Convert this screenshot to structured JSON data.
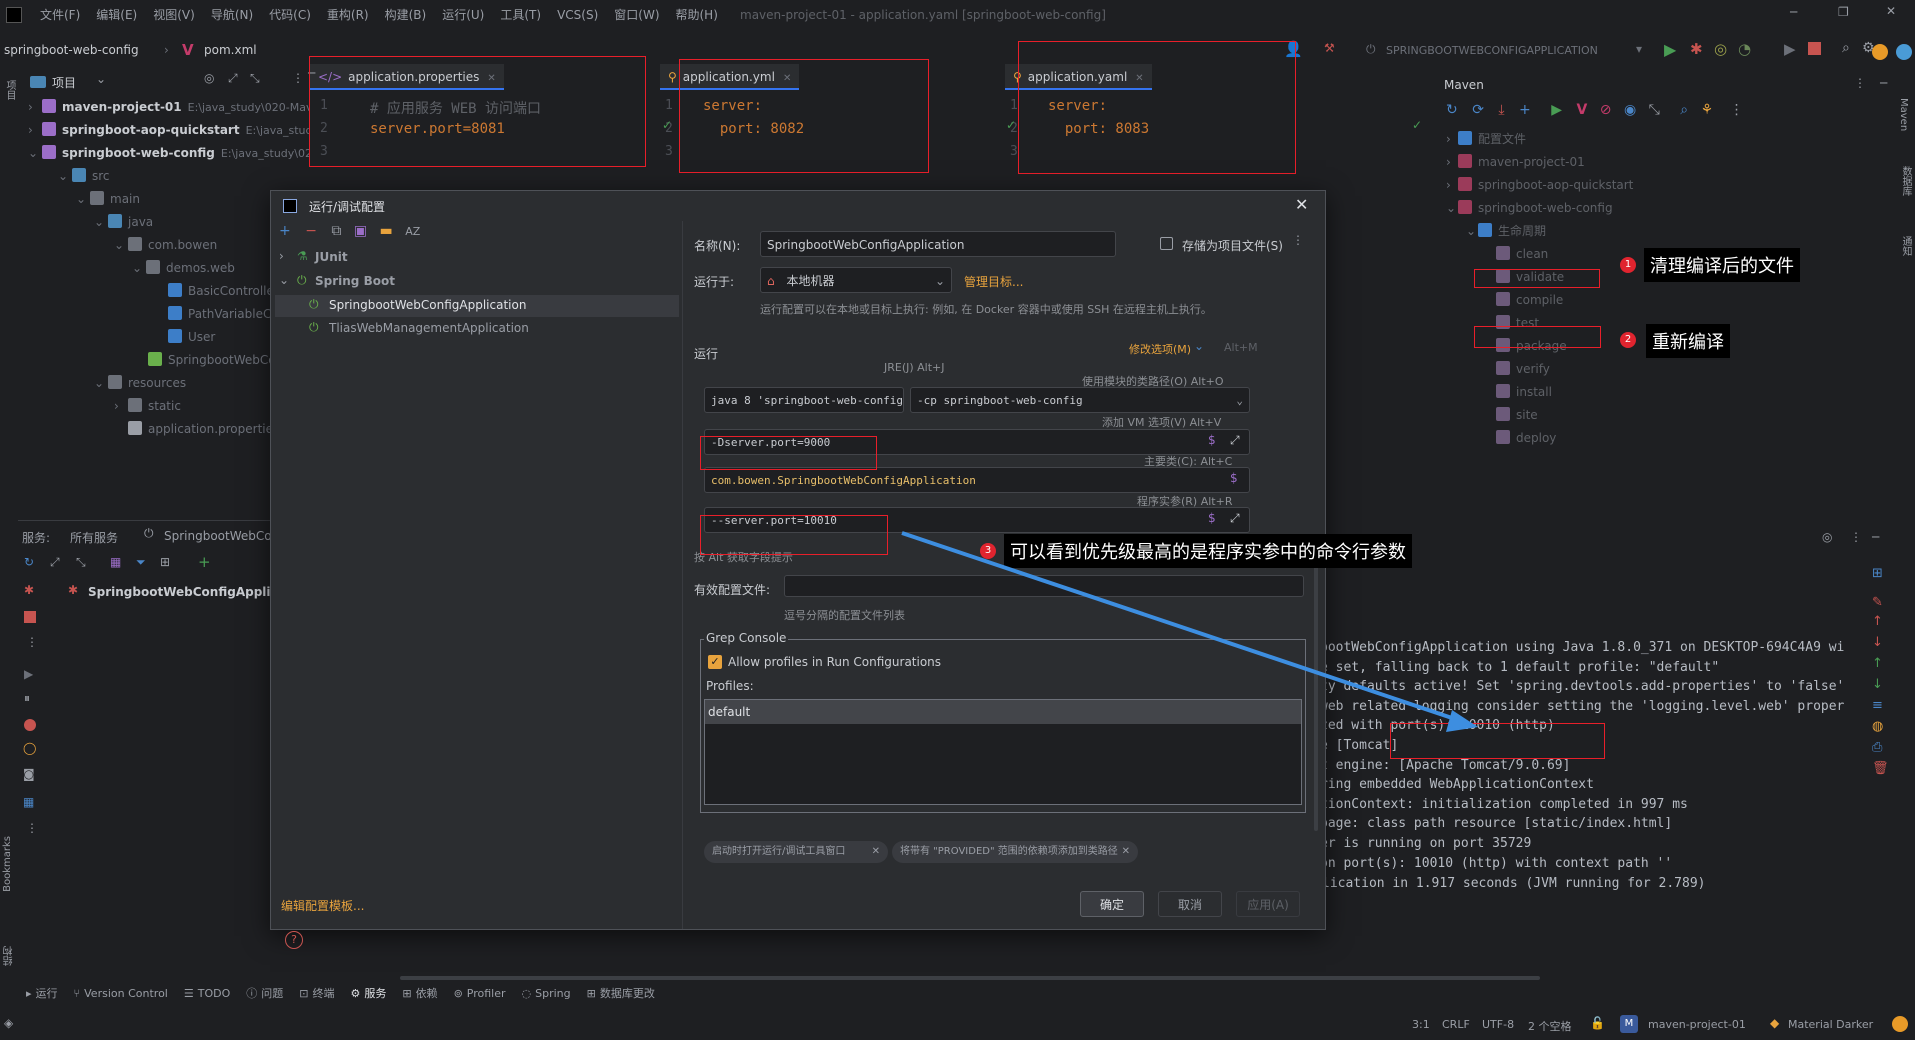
{
  "menubar": {
    "items": [
      "文件(F)",
      "编辑(E)",
      "视图(V)",
      "导航(N)",
      "代码(C)",
      "重构(R)",
      "构建(B)",
      "运行(U)",
      "工具(T)",
      "VCS(S)",
      "窗口(W)",
      "帮助(H)"
    ],
    "window_title": "maven-project-01 - application.yaml [springboot-web-config]"
  },
  "navbar": {
    "project": "springboot-web-config",
    "file": "pom.xml",
    "run_config": "SPRINGBOOTWEBCONFIGAPPLICATION"
  },
  "project_panel": {
    "title": "项目",
    "tree": [
      {
        "label": "maven-project-01",
        "path": "E:\\java_study\\020-Maven\\m"
      },
      {
        "label": "springboot-aop-quickstart",
        "path": "E:\\java_study\\022"
      },
      {
        "label": "springboot-web-config",
        "path": "E:\\java_study\\020-M"
      },
      {
        "label": "src"
      },
      {
        "label": "main"
      },
      {
        "label": "java"
      },
      {
        "label": "com.bowen"
      },
      {
        "label": "demos.web"
      },
      {
        "label": "BasicController"
      },
      {
        "label": "PathVariableContro"
      },
      {
        "label": "User"
      },
      {
        "label": "SpringbootWebConfi"
      },
      {
        "label": "resources"
      },
      {
        "label": "static"
      },
      {
        "label": "application.properties"
      }
    ]
  },
  "editors": [
    {
      "tab": "application.properties",
      "lines": [
        "# 应用服务 WEB 访问端口",
        "server.port=8081"
      ],
      "nums": [
        "1",
        "2",
        "3"
      ]
    },
    {
      "tab": "application.yml",
      "lines": [
        "server:",
        "  port: 8082"
      ],
      "nums": [
        "1",
        "2",
        "3"
      ]
    },
    {
      "tab": "application.yaml",
      "lines": [
        "server:",
        "  port: 8083"
      ],
      "nums": [
        "1",
        "2",
        "3"
      ]
    }
  ],
  "services": {
    "tabs": [
      "服务:",
      "所有服务",
      "SpringbootWebCo"
    ],
    "item": "SpringbootWebConfigApplica"
  },
  "maven": {
    "title": "Maven",
    "items": [
      {
        "label": "配置文件"
      },
      {
        "label": "maven-project-01"
      },
      {
        "label": "springboot-aop-quickstart"
      },
      {
        "label": "springboot-web-config"
      },
      {
        "label": "生命周期"
      },
      {
        "label": "clean"
      },
      {
        "label": "validate"
      },
      {
        "label": "compile"
      },
      {
        "label": "test"
      },
      {
        "label": "package"
      },
      {
        "label": "verify"
      },
      {
        "label": "install"
      },
      {
        "label": "site"
      },
      {
        "label": "deploy"
      }
    ]
  },
  "console": {
    "lines": [
      "bootWebConfigApplication using Java 1.8.0_371 on DESKTOP-694C4A9 wi",
      "e set, falling back to 1 default profile: \"default\"",
      "ty defaults active! Set 'spring.devtools.add-properties' to 'false'",
      "web related logging consider setting the 'logging.level.web' proper",
      "zed with port(s): 10010 (http)",
      "e [Tomcat]",
      "t engine: [Apache Tomcat/9.0.69]",
      "ring embedded WebApplicationContext",
      "tionContext: initialization completed in 997 ms",
      "page: class path resource [static/index.html]",
      "er is running on port 35729",
      "on port(s): 10010 (http) with context path ''"
    ],
    "last_line": "2023-12-04 13:18:08.544  INFO 11004 --- [  restartedMain] c.bowen.SpringbootWebConfigApplication   : Started SpringbootWebConfigApplication in 1.917 seconds (JVM running for 2.789)"
  },
  "dialog": {
    "title": "运行/调试配置",
    "tree": {
      "junit": "JUnit",
      "spring_boot": "Spring Boot",
      "configs": [
        "SpringbootWebConfigApplication",
        "TliasWebManagementApplication"
      ]
    },
    "edit_templates": "编辑配置模板...",
    "name_label": "名称(N):",
    "name_value": "SpringbootWebConfigApplication",
    "store_as_file": "存储为项目文件(S)",
    "run_on_label": "运行于:",
    "run_on_value": "本地机器",
    "manage_targets": "管理目标...",
    "run_on_hint": "运行配置可以在本地或目标上执行: 例如, 在 Docker 容器中或使用 SSH 在远程主机上执行。",
    "run_section": "运行",
    "modify_options": "修改选项(M)",
    "modify_shortcut": "Alt+M",
    "jre_hint": "JRE(J) Alt+J",
    "classpath_hint": "使用模块的类路径(O) Alt+O",
    "jre_value": "java 8 'springboot-web-config' 模",
    "cp_value": "-cp springboot-web-config",
    "vm_hint": "添加 VM 选项(V) Alt+V",
    "vm_value": "-Dserver.port=9000",
    "main_class_hint": "主要类(C): Alt+C",
    "main_class_value": "com.bowen.SpringbootWebConfigApplication",
    "args_hint": "程序实参(R) Alt+R",
    "args_value": "--server.port=10010",
    "alt_hint": "按 Alt 获取字段提示",
    "active_profiles_label": "有效配置文件:",
    "profiles_hint": "逗号分隔的配置文件列表",
    "grep_console": "Grep Console",
    "allow_profiles": "Allow profiles in Run Configurations",
    "profiles_label": "Profiles:",
    "profile_item": "default",
    "chip1": "启动时打开运行/调试工具窗口",
    "chip2": "将带有 \"PROVIDED\" 范围的依赖项添加到类路径",
    "ok": "确定",
    "cancel": "取消",
    "apply": "应用(A)"
  },
  "annotations": {
    "a1": "清理编译后的文件",
    "a2": "重新编译",
    "a3": "可以看到优先级最高的是程序实参中的命令行参数",
    "n1": "1",
    "n2": "2",
    "n3": "3"
  },
  "bottom_tabs": [
    "运行",
    "Version Control",
    "TODO",
    "问题",
    "终端",
    "服务",
    "依赖",
    "Profiler",
    "Spring",
    "数据库更改"
  ],
  "statusbar": {
    "pos": "3:1",
    "eol": "CRLF",
    "enc": "UTF-8",
    "indent": "2 个空格",
    "project": "maven-project-01",
    "theme": "Material Darker"
  },
  "left_strip": [
    "项目",
    "Bookmarks",
    "结构"
  ],
  "right_strip": [
    "Maven",
    "数据库",
    "通知"
  ]
}
